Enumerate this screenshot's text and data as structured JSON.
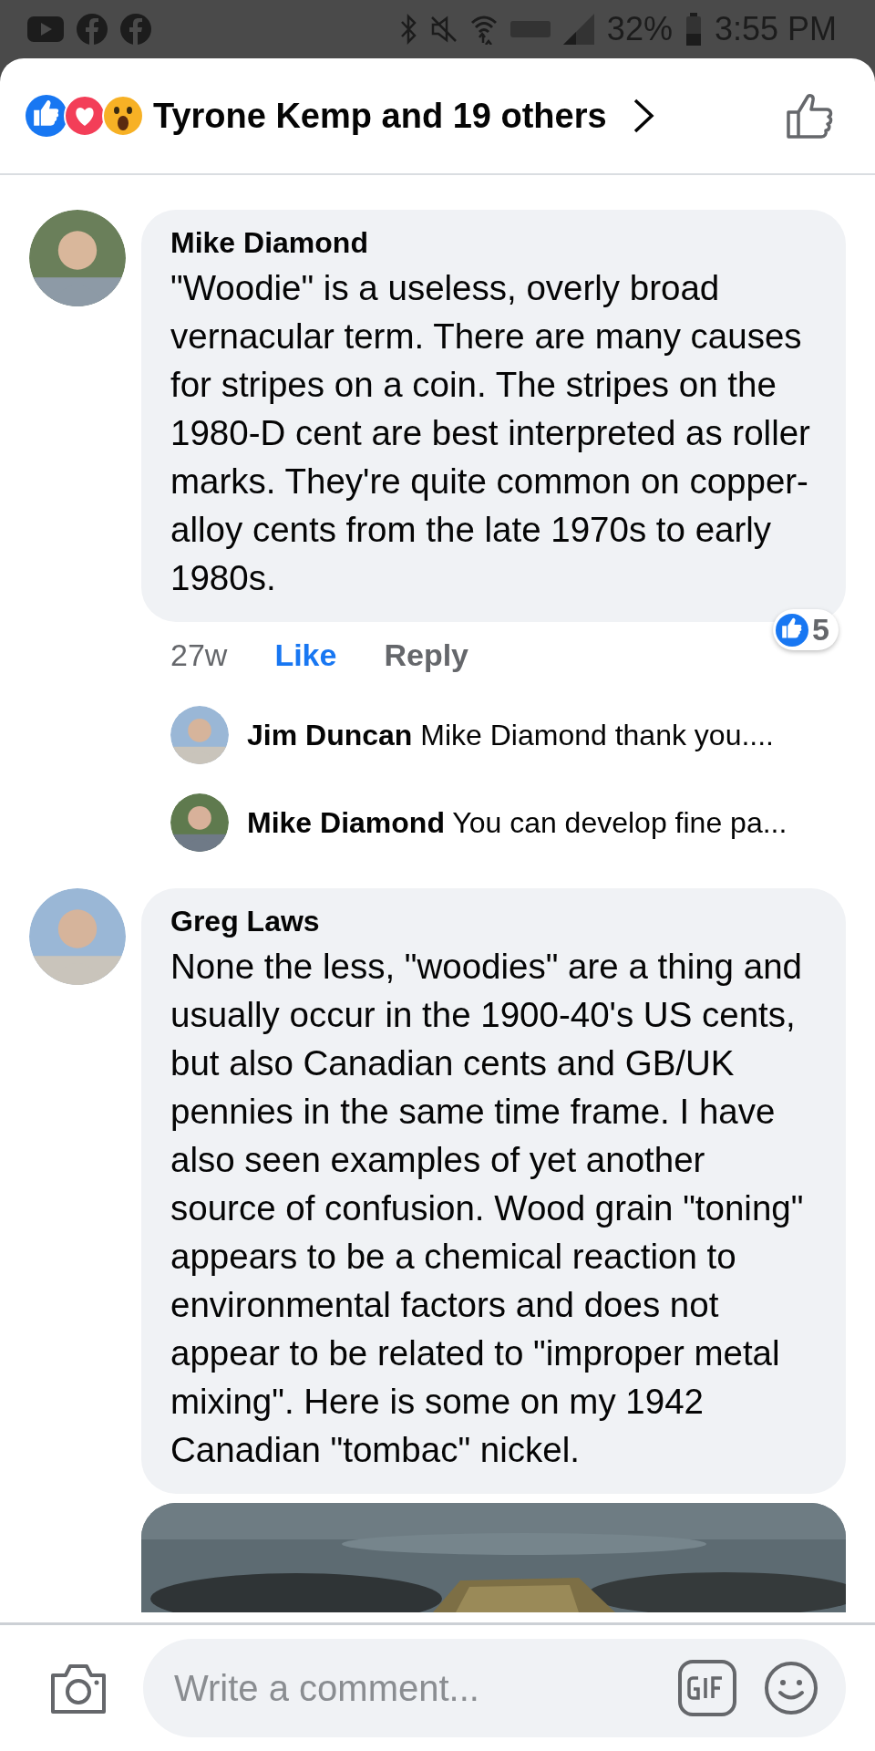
{
  "status_bar": {
    "battery": "32%",
    "time": "3:55 PM"
  },
  "header": {
    "reactors": "Tyrone Kemp and 19 others"
  },
  "comments": [
    {
      "author": "Mike Diamond",
      "text": "\"Woodie\" is a useless, overly broad vernacular term.  There are many causes for stripes on a coin.  The stripes on the 1980-D cent are best interpreted as roller marks.  They're quite common on copper-alloy cents from the late 1970s to early 1980s.",
      "time": "27w",
      "like": "Like",
      "liked": true,
      "reply": "Reply",
      "reaction_count": "5",
      "replies": [
        {
          "author": "Jim Duncan",
          "text": "Mike Diamond thank you...."
        },
        {
          "author": "Mike Diamond",
          "text": "You can develop fine pa..."
        }
      ]
    },
    {
      "author": "Greg Laws",
      "text": "None the less, \"woodies\" are a thing and usually occur in the 1900-40's US cents, but also Canadian cents and GB/UK pennies in the same time frame. I have also seen examples of yet another source of confusion. Wood grain \"toning\" appears to be a chemical reaction to environmental factors and does not appear to be related to \"improper metal mixing\". Here is some on my 1942 Canadian \"tombac\" nickel."
    }
  ],
  "composer": {
    "placeholder": "Write a comment..."
  }
}
